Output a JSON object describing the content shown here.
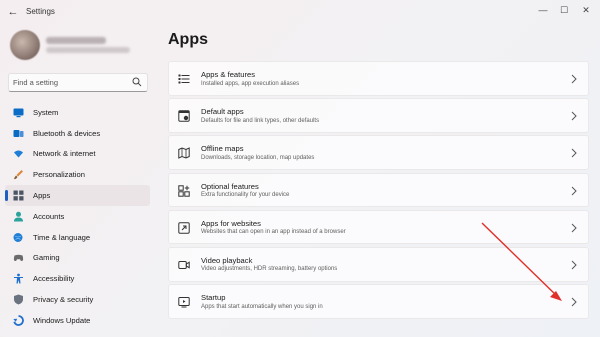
{
  "window": {
    "title": "Settings",
    "back_glyph": "←",
    "minimize_glyph": "—",
    "maximize_glyph": "☐",
    "close_glyph": "✕"
  },
  "search": {
    "placeholder": "Find a setting",
    "icon": "search-icon"
  },
  "sidebar": {
    "items": [
      {
        "label": "System",
        "icon": "system-icon",
        "color": "#0a6cc4"
      },
      {
        "label": "Bluetooth & devices",
        "icon": "bluetooth-icon",
        "color": "#0a6cc4"
      },
      {
        "label": "Network & internet",
        "icon": "wifi-icon",
        "color": "#1f7fd6"
      },
      {
        "label": "Personalization",
        "icon": "brush-icon",
        "color": "#d98a3a"
      },
      {
        "label": "Apps",
        "icon": "apps-icon",
        "color": "#4b5563",
        "active": true
      },
      {
        "label": "Accounts",
        "icon": "account-icon",
        "color": "#2aa39c"
      },
      {
        "label": "Time & language",
        "icon": "globe-clock-icon",
        "color": "#1f7fd6"
      },
      {
        "label": "Gaming",
        "icon": "gamepad-icon",
        "color": "#6b6b6b"
      },
      {
        "label": "Accessibility",
        "icon": "accessibility-icon",
        "color": "#1f6fcf"
      },
      {
        "label": "Privacy & security",
        "icon": "shield-icon",
        "color": "#6b7280"
      },
      {
        "label": "Windows Update",
        "icon": "update-icon",
        "color": "#1f6fcf"
      }
    ]
  },
  "main": {
    "title": "Apps",
    "cards": [
      {
        "title": "Apps & features",
        "desc": "Installed apps, app execution aliases",
        "icon": "apps-features-icon"
      },
      {
        "title": "Default apps",
        "desc": "Defaults for file and link types, other defaults",
        "icon": "default-apps-icon"
      },
      {
        "title": "Offline maps",
        "desc": "Downloads, storage location, map updates",
        "icon": "offline-maps-icon"
      },
      {
        "title": "Optional features",
        "desc": "Extra functionality for your device",
        "icon": "optional-features-icon"
      },
      {
        "title": "Apps for websites",
        "desc": "Websites that can open in an app instead of a browser",
        "icon": "apps-websites-icon"
      },
      {
        "title": "Video playback",
        "desc": "Video adjustments, HDR streaming, battery options",
        "icon": "video-playback-icon"
      },
      {
        "title": "Startup",
        "desc": "Apps that start automatically when you sign in",
        "icon": "startup-icon"
      }
    ]
  },
  "colors": {
    "accent": "#1e5fc1",
    "annotation": "#e0302a"
  }
}
